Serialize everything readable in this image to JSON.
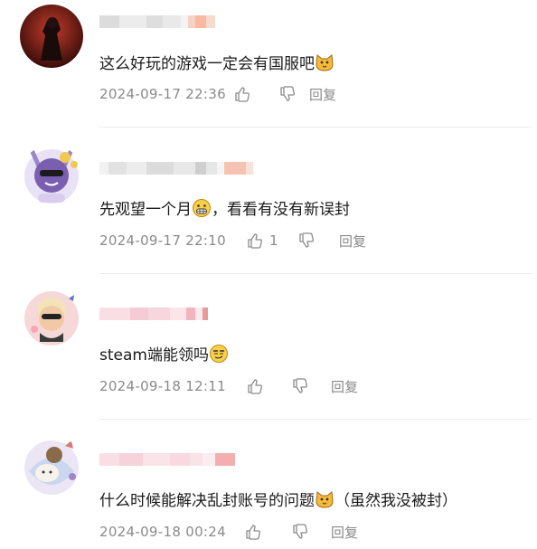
{
  "comments": [
    {
      "text": "这么好玩的游戏一定会有国服吧",
      "emoji": "cat-face",
      "date": "2024-09-17 22:36",
      "likes": "",
      "reply_label": "回复"
    },
    {
      "text_before": "先观望一个月",
      "text_after": "，看看有没有新误封",
      "emoji": "grimacing-face",
      "date": "2024-09-17 22:10",
      "likes": "1",
      "reply_label": "回复"
    },
    {
      "text": "steam端能领吗",
      "emoji": "smirking-face",
      "date": "2024-09-18 12:11",
      "likes": "",
      "reply_label": "回复"
    },
    {
      "text_before": "什么时候能解决乱封账号的问题",
      "text_after": "（虽然我没被封）",
      "emoji": "cat-face",
      "date": "2024-09-18 00:24",
      "likes": "",
      "reply_label": "回复"
    }
  ],
  "colors": {
    "meta": "#8a8a8a",
    "divider": "#ececec",
    "name_blur": "#e6e6e6",
    "name_blur_pink": "#f7c9cf"
  }
}
